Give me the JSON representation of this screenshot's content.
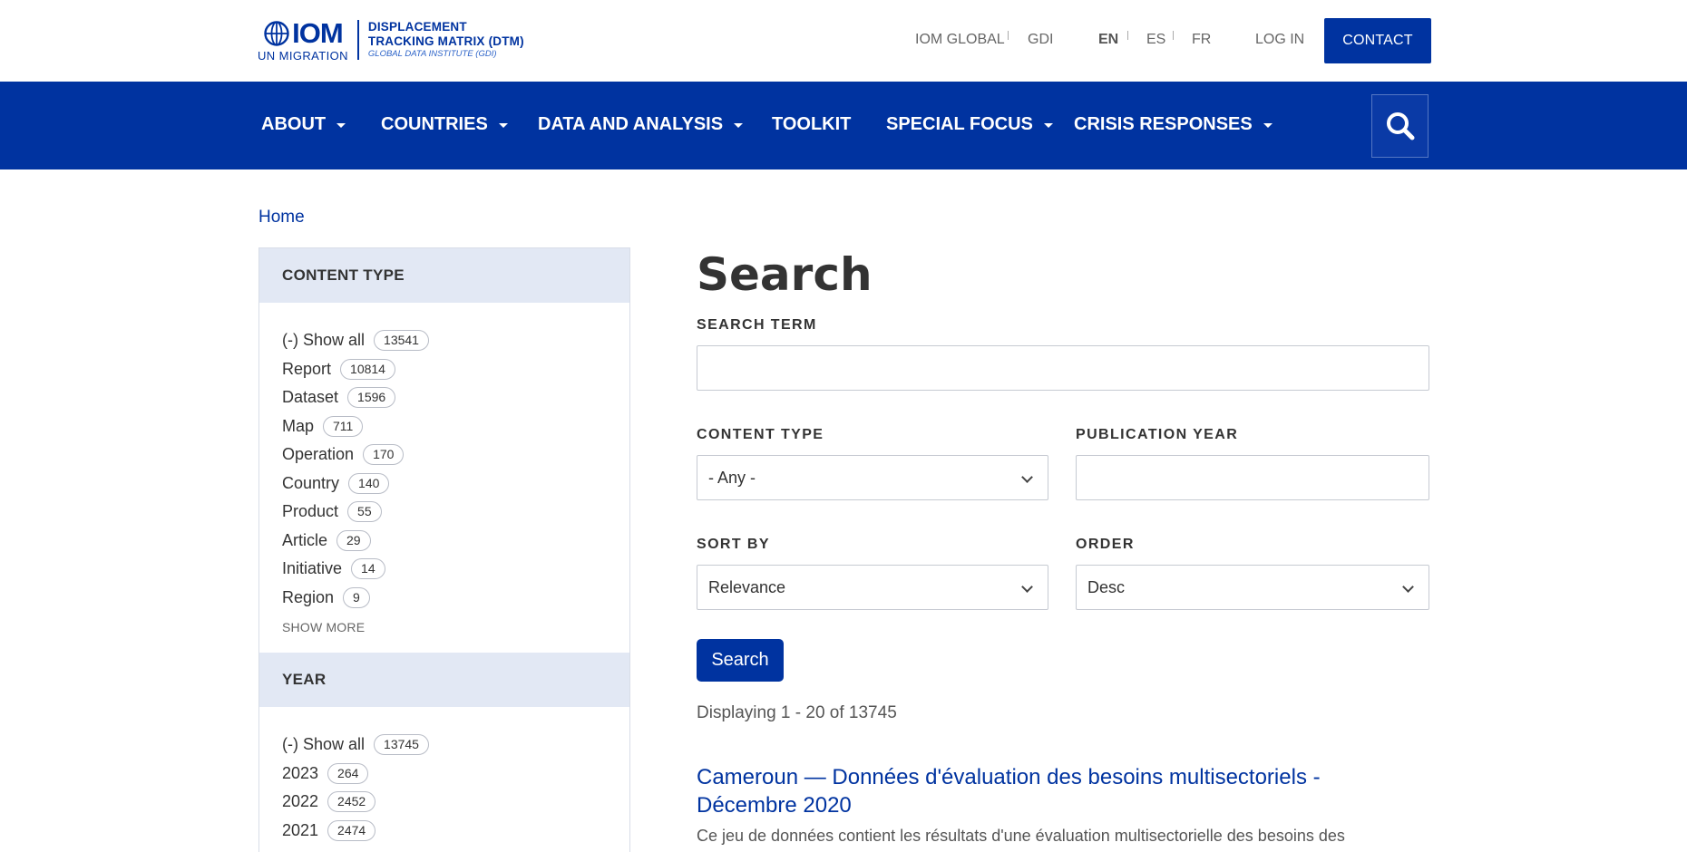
{
  "header": {
    "logo": {
      "org_short": "IOM",
      "org_sub": "UN MIGRATION",
      "dtm_line1": "DISPLACEMENT",
      "dtm_line2": "TRACKING MATRIX (DTM)",
      "dtm_sub": "GLOBAL DATA INSTITUTE (GDI)"
    },
    "links": {
      "iom_global": "IOM GLOBAL",
      "gdi": "GDI",
      "lang_en": "EN",
      "lang_es": "ES",
      "lang_fr": "FR",
      "login": "LOG IN",
      "contact": "CONTACT"
    },
    "brand_color": "#0033a0"
  },
  "nav": {
    "items": [
      {
        "label": "ABOUT",
        "dropdown": true
      },
      {
        "label": "COUNTRIES",
        "dropdown": true
      },
      {
        "label": "DATA AND ANALYSIS",
        "dropdown": true
      },
      {
        "label": "TOOLKIT",
        "dropdown": false
      },
      {
        "label": "SPECIAL FOCUS",
        "dropdown": true
      },
      {
        "label": "CRISIS RESPONSES",
        "dropdown": true
      }
    ],
    "search_icon": "search-icon"
  },
  "breadcrumb": {
    "home": "Home"
  },
  "sidebar": {
    "content_type": {
      "title": "CONTENT TYPE",
      "items": [
        {
          "label": "(-) Show all",
          "count": "13541"
        },
        {
          "label": "Report",
          "count": "10814"
        },
        {
          "label": "Dataset",
          "count": "1596"
        },
        {
          "label": "Map",
          "count": "711"
        },
        {
          "label": "Operation",
          "count": "170"
        },
        {
          "label": "Country",
          "count": "140"
        },
        {
          "label": "Product",
          "count": "55"
        },
        {
          "label": "Article",
          "count": "29"
        },
        {
          "label": "Initiative",
          "count": "14"
        },
        {
          "label": "Region",
          "count": "9"
        }
      ],
      "show_more": "SHOW MORE"
    },
    "year": {
      "title": "YEAR",
      "items": [
        {
          "label": "(-) Show all",
          "count": "13745"
        },
        {
          "label": "2023",
          "count": "264"
        },
        {
          "label": "2022",
          "count": "2452"
        },
        {
          "label": "2021",
          "count": "2474"
        }
      ]
    }
  },
  "main": {
    "title": "Search",
    "search_term_label": "SEARCH TERM",
    "search_term_value": "",
    "content_type_label": "CONTENT TYPE",
    "content_type_value": "- Any -",
    "publication_year_label": "PUBLICATION YEAR",
    "publication_year_value": "",
    "sort_by_label": "SORT BY",
    "sort_by_value": "Relevance",
    "order_label": "ORDER",
    "order_value": "Desc",
    "search_button": "Search",
    "displaying": "Displaying 1 - 20 of 13745",
    "results": [
      {
        "title": "Cameroun — Données d'évaluation des besoins multisectoriels - Décembre 2020",
        "description": "Ce jeu de données contient les résultats d'une évaluation multisectorielle des besoins des"
      }
    ]
  }
}
